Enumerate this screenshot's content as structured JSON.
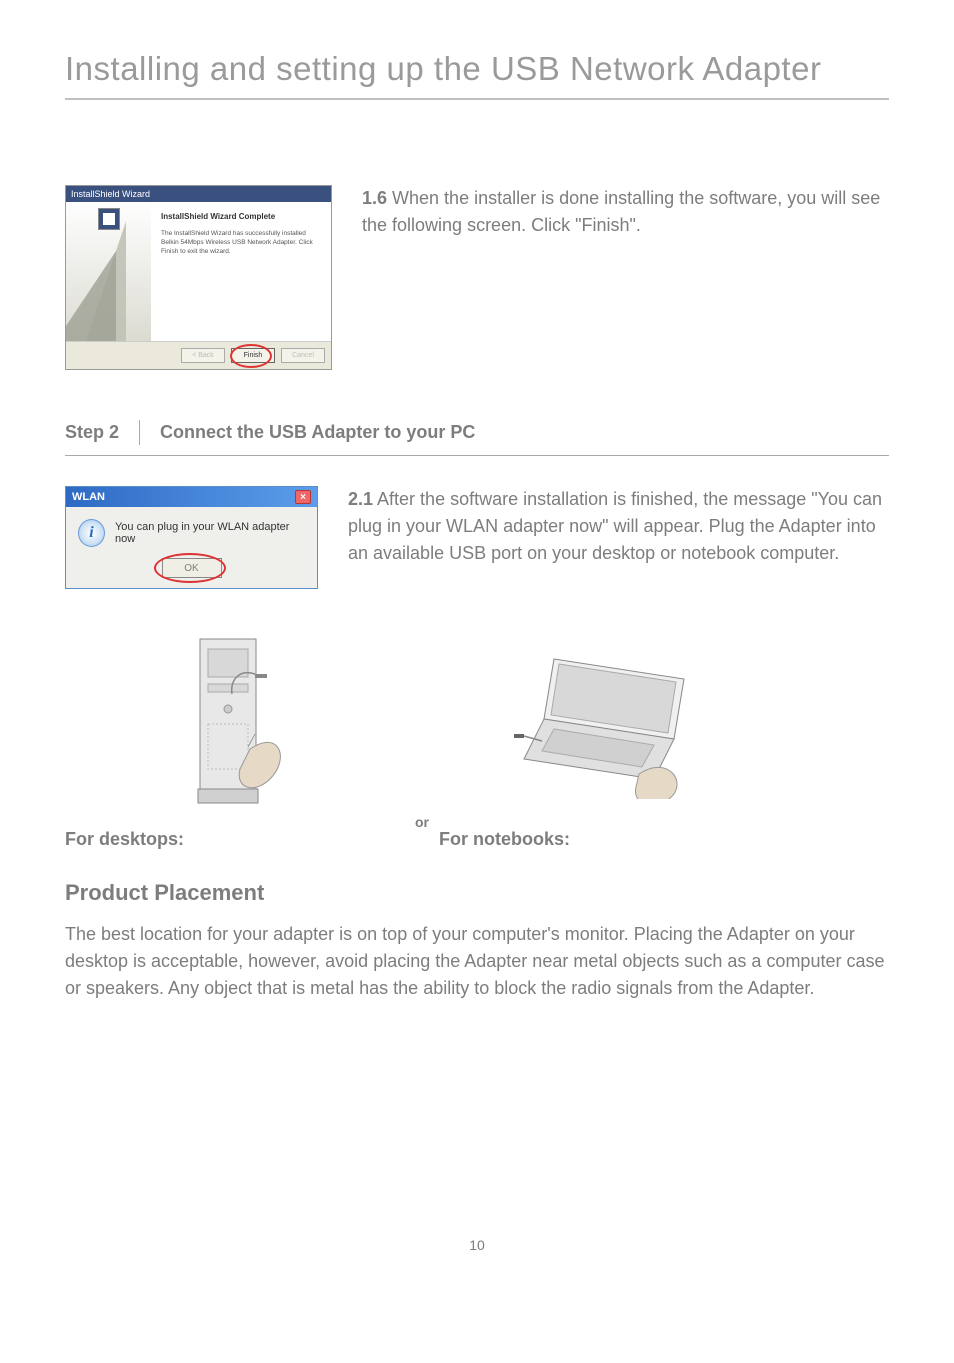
{
  "pageTitle": "Installing and setting up the USB Network Adapter",
  "wizard": {
    "titlebar": "InstallShield Wizard",
    "heading": "InstallShield Wizard Complete",
    "body": "The InstallShield Wizard has successfully installed Belkin 54Mbps Wireless USB Network Adapter. Click Finish to exit the wizard.",
    "backBtn": "< Back",
    "finishBtn": "Finish",
    "cancelBtn": "Cancel"
  },
  "s1_6": {
    "num": "1.6",
    "text": " When the installer is done installing the software, you will see the following screen. Click \"Finish\"."
  },
  "step2Label": "Step 2",
  "step2Title": "Connect the USB Adapter to your PC",
  "wlan": {
    "title": "WLAN",
    "msg": "You can plug in your WLAN adapter now",
    "ok": "OK"
  },
  "s2_1": {
    "num": "2.1",
    "text": " After the software installation is finished, the message \"You can plug in your WLAN adapter now\" will appear. Plug the Adapter into an available USB port on your desktop or notebook computer."
  },
  "forDesktops": "For desktops:",
  "forNotebooks": "For notebooks:",
  "orText": "or",
  "productHeading": "Product Placement",
  "productText": "The best location for your adapter is on top of your computer's monitor. Placing the Adapter on your desktop is acceptable, however, avoid placing the Adapter near metal objects such as a computer case or speakers. Any object that is metal has the ability to block the radio signals from the Adapter.",
  "pageNum": "10"
}
